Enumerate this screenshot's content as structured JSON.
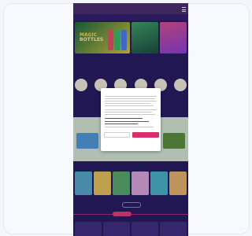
{
  "header": {
    "logo_line1": "",
    "logo_line2": ""
  },
  "nav": {
    "items": [
      "",
      "",
      "",
      "",
      "",
      "",
      "",
      ""
    ]
  },
  "hero": {
    "title_line1": "MAGIC",
    "title_line2": "BOTTLES"
  },
  "sections": {
    "categories_title": "",
    "games_title": ""
  },
  "categories": {
    "labels": [
      "",
      "",
      "",
      "",
      "",
      ""
    ]
  },
  "pager": {
    "label": "·····"
  },
  "consent_dialog": {
    "title": "",
    "reject_label": "",
    "accept_label": "",
    "link_label": ""
  },
  "colors": {
    "page_bg": "#f4f6fb",
    "site_bg": "#271c5e",
    "accent": "#d92d6e"
  }
}
